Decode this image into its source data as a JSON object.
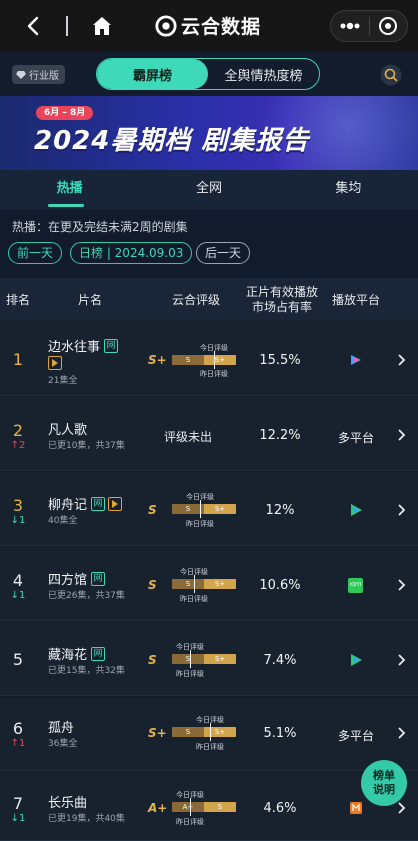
{
  "app": {
    "title": "云合数据"
  },
  "filter": {
    "industry_tag": "行业版",
    "seg_active": "霸屏榜",
    "seg_inactive": "全舆情热度榜"
  },
  "banner": {
    "date_pill": "6月 – 8月",
    "title": "2024暑期档 剧集报告"
  },
  "tabs": [
    "热播",
    "全网",
    "集均"
  ],
  "description": "热播：在更及完结未满2周的剧集",
  "datebar": {
    "prev": "前一天",
    "current": "日榜 | 2024.09.03",
    "next": "后一天"
  },
  "table_header": {
    "rank": "排名",
    "name": "片名",
    "grade": "云合评级",
    "share_line1": "正片有效播放",
    "share_line2": "市场占有率",
    "platform": "播放平台"
  },
  "grade_labels": {
    "today": "今日评级",
    "yesterday": "昨日评级"
  },
  "rows": [
    {
      "rank": "1",
      "trend": "",
      "name": "边水往事",
      "badge_net": "网",
      "info": "21集全",
      "grade": "S+",
      "seg_left": "S",
      "seg_right": "S+",
      "share": "15.5%",
      "platform": "youku-icon"
    },
    {
      "rank": "2",
      "trend": "↑2",
      "name": "凡人歌",
      "badge_net": "",
      "info": "已更10集，共37集",
      "grade": "评级未出",
      "seg_left": "",
      "seg_right": "",
      "share": "12.2%",
      "platform_text": "多平台"
    },
    {
      "rank": "3",
      "trend": "↓1",
      "name": "柳舟记",
      "badge_net": "网",
      "info": "40集全",
      "grade": "S",
      "seg_left": "S",
      "seg_right": "S+",
      "share": "12%",
      "platform": "tencent-video-icon"
    },
    {
      "rank": "4",
      "trend": "↓1",
      "name": "四方馆",
      "badge_net": "网",
      "info": "已更26集，共37集",
      "grade": "S",
      "seg_left": "S",
      "seg_right": "S+",
      "share": "10.6%",
      "platform": "iqiyi-icon",
      "platform_label": "iQIYI"
    },
    {
      "rank": "5",
      "trend": "",
      "name": "藏海花",
      "badge_net": "网",
      "info": "已更15集，共32集",
      "grade": "S",
      "seg_left": "S",
      "seg_right": "S+",
      "share": "7.4%",
      "platform": "tencent-video-icon"
    },
    {
      "rank": "6",
      "trend": "↑1",
      "name": "孤舟",
      "badge_net": "",
      "info": "36集全",
      "grade": "S+",
      "seg_left": "S",
      "seg_right": "S+",
      "share": "5.1%",
      "platform_text": "多平台"
    },
    {
      "rank": "7",
      "trend": "↓1",
      "name": "长乐曲",
      "badge_net": "",
      "info": "已更19集，共40集",
      "grade": "A+",
      "seg_left": "A+",
      "seg_right": "S",
      "share": "4.6%",
      "platform": "mango-tv-icon"
    }
  ],
  "float_button": {
    "line1": "榜单",
    "line2": "说明"
  },
  "colors": {
    "accent": "#3dd9b9",
    "gold": "#e3b34a",
    "up": "#e8445a",
    "down": "#3dd9b9"
  }
}
